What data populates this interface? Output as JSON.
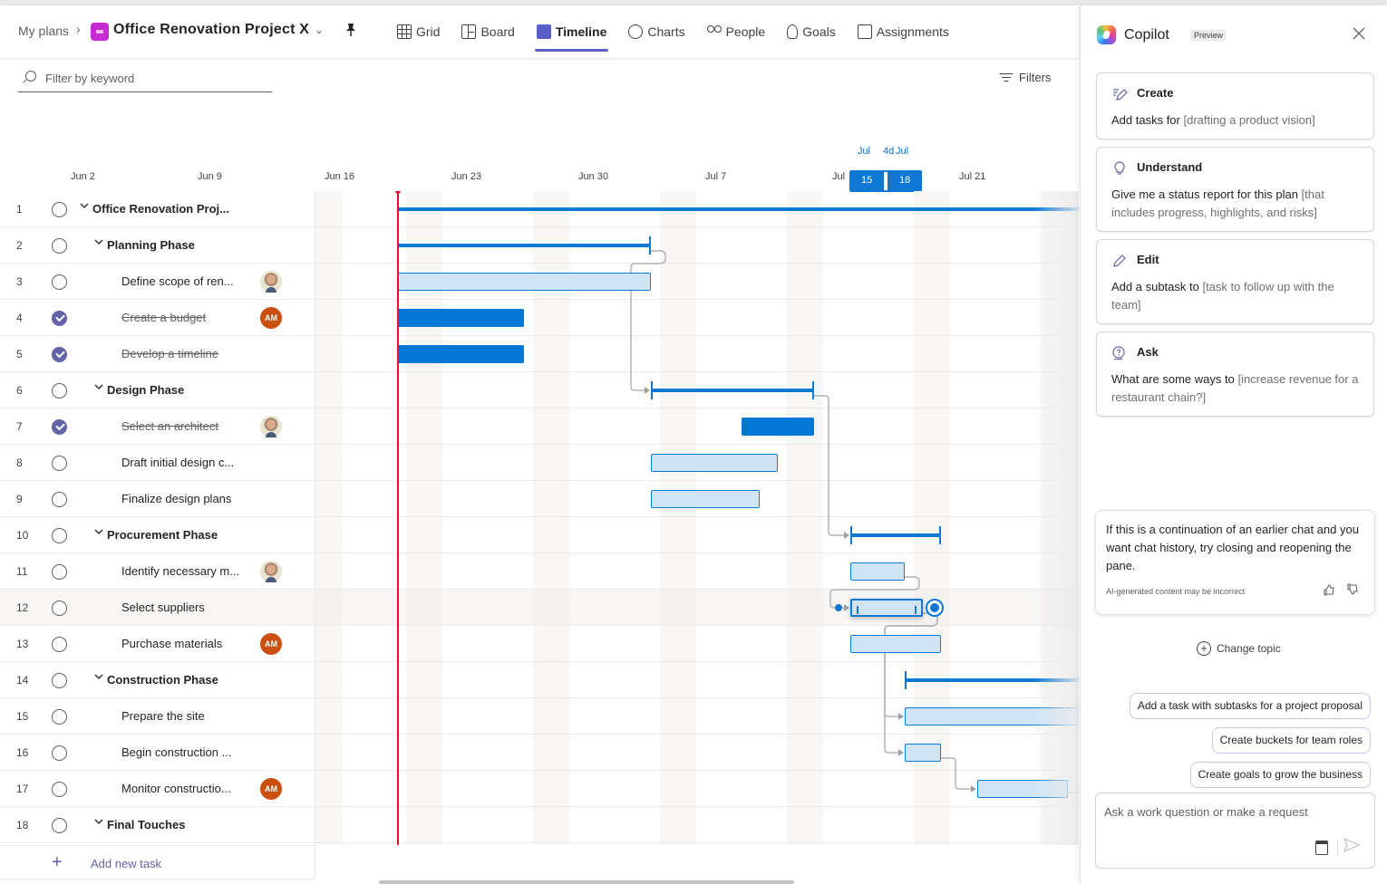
{
  "header": {
    "breadcrumb_root": "My plans",
    "breadcrumb_sep": "›",
    "plan_title": "Office Renovation Project X",
    "title_chevron": "⌄",
    "pin_icon": "📌",
    "tabs": [
      {
        "label": "Grid",
        "icon": "grid-icon",
        "active": false
      },
      {
        "label": "Board",
        "icon": "board-icon",
        "active": false
      },
      {
        "label": "Timeline",
        "icon": "timeline-icon",
        "active": true
      },
      {
        "label": "Charts",
        "icon": "charts-icon",
        "active": false
      },
      {
        "label": "People",
        "icon": "people-icon",
        "active": false
      },
      {
        "label": "Goals",
        "icon": "goals-icon",
        "active": false
      },
      {
        "label": "Assignments",
        "icon": "assignments-icon",
        "active": false
      }
    ]
  },
  "toolbar": {
    "filter_placeholder": "Filter by keyword",
    "filter_value": "",
    "filters_label": "Filters"
  },
  "timeline": {
    "date_labels": [
      "Jun 2",
      "Jun 9",
      "Jun 16",
      "Jun 23",
      "Jun 30",
      "Jul 7",
      "Jul",
      "Jul 21"
    ],
    "selection": {
      "start_month": "Jul",
      "start_day": "15",
      "duration": "4d",
      "end_month": "Jul",
      "end_day": "18"
    },
    "today": "Jun 20",
    "accent_color": "#0f78d4",
    "today_color": "#e81123"
  },
  "tasks": [
    {
      "num": "1",
      "name": "Office Renovation Proj...",
      "level": 0,
      "group": true,
      "done": false,
      "assignee": null,
      "start": "Jun 20",
      "end": null
    },
    {
      "num": "2",
      "name": "Planning Phase",
      "level": 1,
      "group": true,
      "done": false,
      "assignee": null,
      "start": "Jun 20",
      "end": "Jul 3"
    },
    {
      "num": "3",
      "name": "Define scope of ren...",
      "level": 2,
      "group": false,
      "done": false,
      "assignee": "photo",
      "start": "Jun 20",
      "end": "Jul 3"
    },
    {
      "num": "4",
      "name": "Create a budget",
      "level": 2,
      "group": false,
      "done": true,
      "assignee": "AM",
      "start": "Jun 20",
      "end": "Jun 26"
    },
    {
      "num": "5",
      "name": "Develop a timeline",
      "level": 2,
      "group": false,
      "done": true,
      "assignee": null,
      "start": "Jun 20",
      "end": "Jun 26"
    },
    {
      "num": "6",
      "name": "Design Phase",
      "level": 1,
      "group": true,
      "done": false,
      "assignee": null,
      "start": "Jul 4",
      "end": "Jul 12"
    },
    {
      "num": "7",
      "name": "Select an architect",
      "level": 2,
      "group": false,
      "done": true,
      "assignee": "photo",
      "start": "Jul 9",
      "end": "Jul 12"
    },
    {
      "num": "8",
      "name": "Draft initial design c...",
      "level": 2,
      "group": false,
      "done": false,
      "assignee": null,
      "start": "Jul 4",
      "end": "Jul 10"
    },
    {
      "num": "9",
      "name": "Finalize design plans",
      "level": 2,
      "group": false,
      "done": false,
      "assignee": null,
      "start": "Jul 4",
      "end": "Jul 9"
    },
    {
      "num": "10",
      "name": "Procurement Phase",
      "level": 1,
      "group": true,
      "done": false,
      "assignee": null,
      "start": "Jul 15",
      "end": "Jul 19"
    },
    {
      "num": "11",
      "name": "Identify necessary m...",
      "level": 2,
      "group": false,
      "done": false,
      "assignee": "photo",
      "start": "Jul 15",
      "end": "Jul 17"
    },
    {
      "num": "12",
      "name": "Select suppliers",
      "level": 2,
      "group": false,
      "done": false,
      "assignee": null,
      "start": "Jul 15",
      "end": "Jul 18",
      "selected": true
    },
    {
      "num": "13",
      "name": "Purchase materials",
      "level": 2,
      "group": false,
      "done": false,
      "assignee": "AM",
      "start": "Jul 15",
      "end": "Jul 19"
    },
    {
      "num": "14",
      "name": "Construction Phase",
      "level": 1,
      "group": true,
      "done": false,
      "assignee": null,
      "start": "Jul 18",
      "end": null
    },
    {
      "num": "15",
      "name": "Prepare the site",
      "level": 2,
      "group": false,
      "done": false,
      "assignee": null,
      "start": "Jul 18",
      "end": null
    },
    {
      "num": "16",
      "name": "Begin construction ...",
      "level": 2,
      "group": false,
      "done": false,
      "assignee": null,
      "start": "Jul 18",
      "end": "Jul 19"
    },
    {
      "num": "17",
      "name": "Monitor constructio...",
      "level": 2,
      "group": false,
      "done": false,
      "assignee": "AM",
      "start": "Jul 22",
      "end": "Jul 26"
    },
    {
      "num": "18",
      "name": "Final Touches",
      "level": 1,
      "group": true,
      "done": false,
      "assignee": null,
      "start": null,
      "end": null
    }
  ],
  "add_task": {
    "icon": "+",
    "label": "Add new task"
  },
  "copilot": {
    "title": "Copilot",
    "badge": "Preview",
    "close_icon": "✕",
    "cards": [
      {
        "icon": "create-icon",
        "glyph": "✎",
        "title": "Create",
        "text": "Add tasks for ",
        "hint": "[drafting a product vision]"
      },
      {
        "icon": "lightbulb-icon",
        "glyph": "💡",
        "title": "Understand",
        "text": "Give me a status report for this plan ",
        "hint": "[that includes progress, highlights, and risks]"
      },
      {
        "icon": "pencil-icon",
        "glyph": "✏",
        "title": "Edit",
        "text": "Add a subtask to ",
        "hint": "[task to follow up with the team]"
      },
      {
        "icon": "ask-icon",
        "glyph": "?",
        "title": "Ask",
        "text": "What are some ways to ",
        "hint": "[increase revenue for a restaurant chain?]"
      }
    ],
    "message": "If this is a continuation of an earlier chat and you want chat history, try closing and reopening the pane.",
    "disclaimer": "AI-generated content may be incorrect",
    "thumbs_up": "👍",
    "thumbs_down": "👎",
    "change_topic": "Change topic",
    "suggestions": [
      "Add a task with subtasks for a project proposal",
      "Create buckets for team roles",
      "Create goals to grow the business"
    ],
    "input_placeholder": "Ask a work question or make a request",
    "input_value": ""
  }
}
